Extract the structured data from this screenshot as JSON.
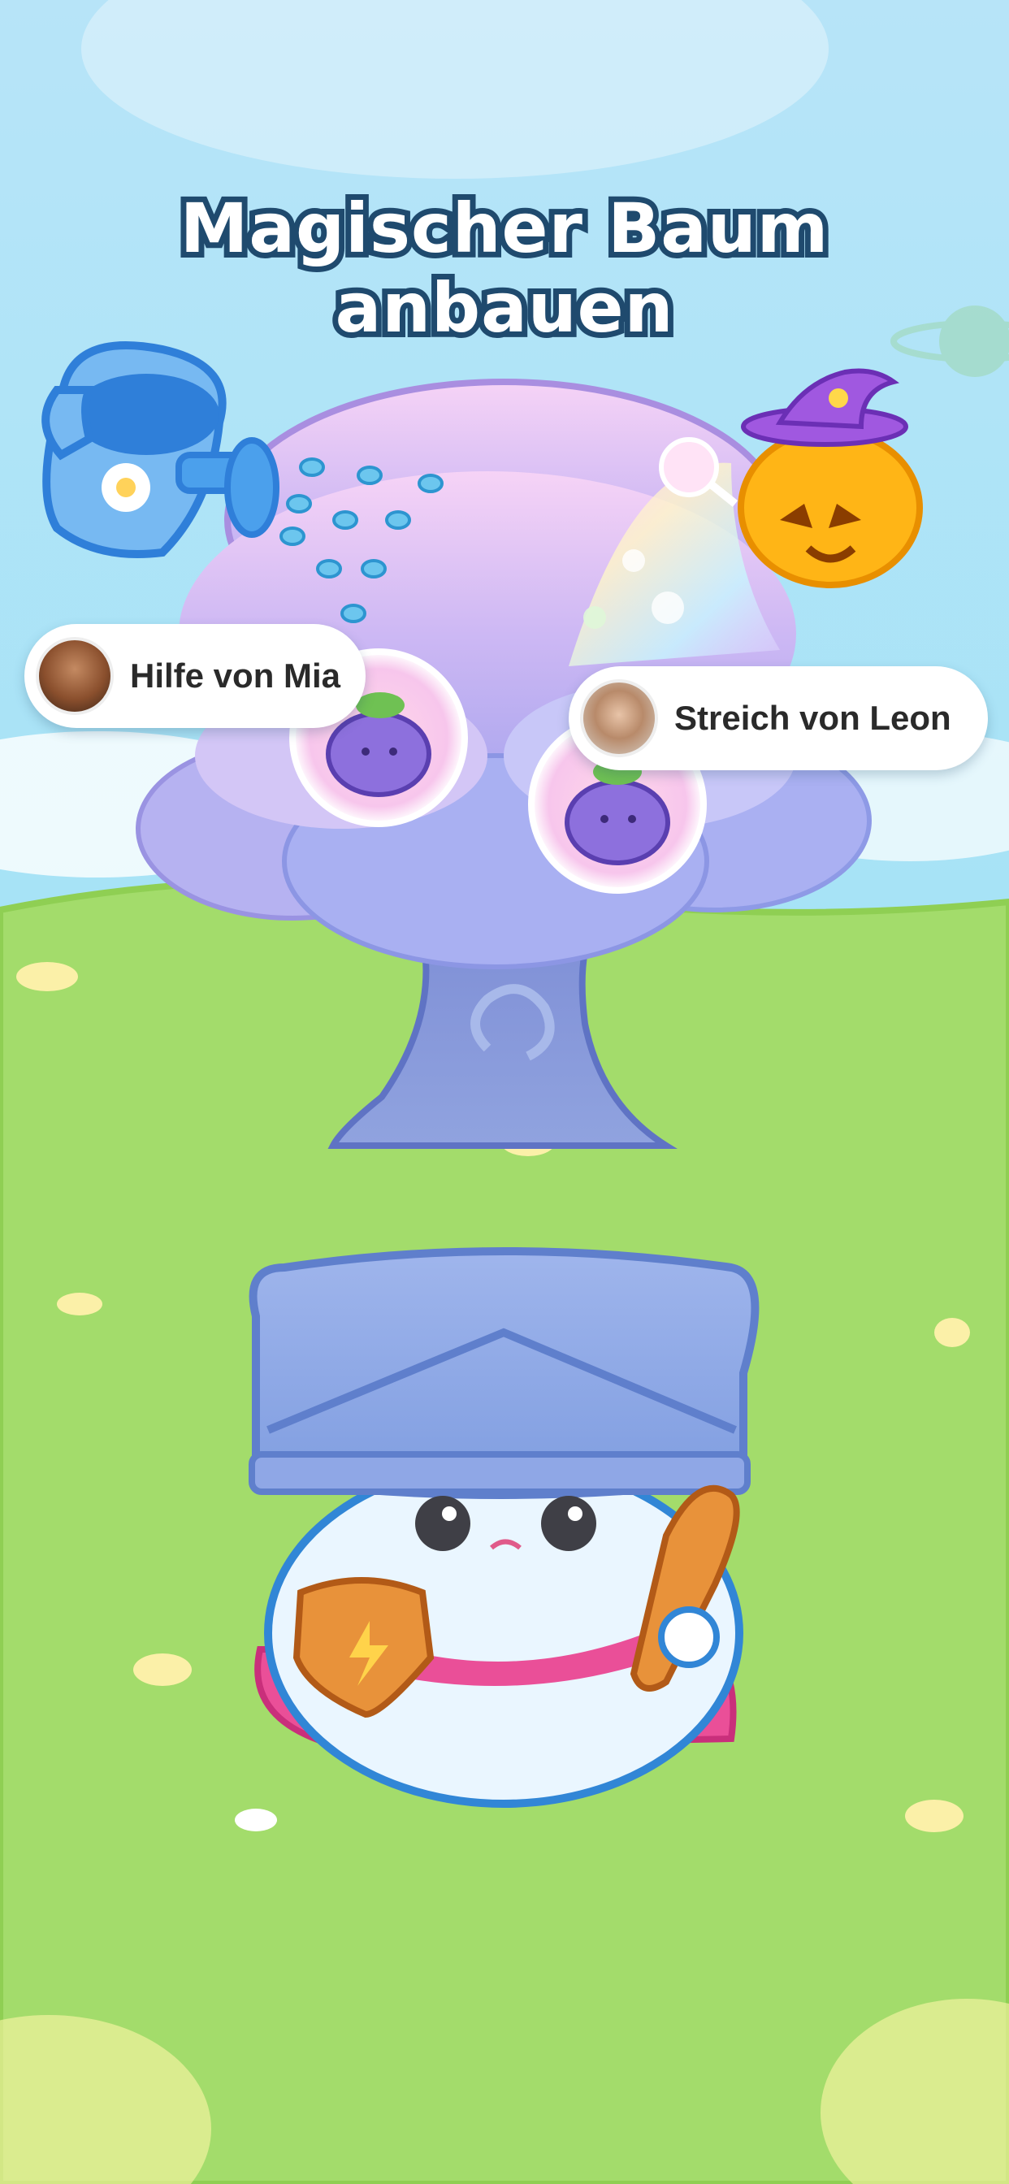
{
  "title": "Magischer Baum anbauen",
  "helpers": [
    {
      "text": "Hilfe von Mia",
      "avatar": "avatar-photo-woman"
    },
    {
      "text": "Streich von Leon",
      "avatar": "avatar-photo-woman"
    }
  ],
  "icons": {
    "watering_can": "watering-can-icon",
    "pumpkin": "witch-pumpkin-icon",
    "tree": "magic-tree-icon",
    "fruit": "grape-fruit-icon",
    "mascot": "knight-mascot-icon"
  },
  "colors": {
    "sky": "#aee3f5",
    "grass": "#a3dc6b",
    "tree_canopy": "#b9a8f0",
    "title_outline": "#1f4a6e"
  }
}
